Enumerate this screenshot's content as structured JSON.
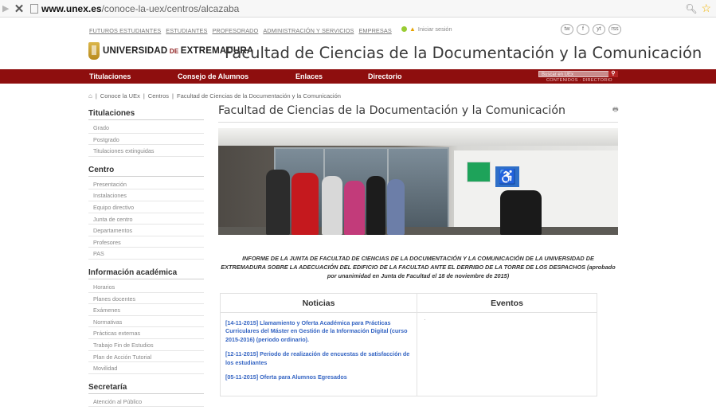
{
  "browser": {
    "url_host": "www.unex.es",
    "url_path": "/conoce-la-uex/centros/alcazaba"
  },
  "toplinks": [
    "Futuros estudiantes",
    "Estudiantes",
    "Profesorado",
    "Administración y servicios",
    "Empresas"
  ],
  "login_label": "Iniciar sesión",
  "social": [
    "tw",
    "f",
    "yt",
    "rss"
  ],
  "logo_text": {
    "a": "UNIVERSIDAD",
    "b": " DE ",
    "c": "EXTREMADURA"
  },
  "site_title": "Facultad de Ciencias de la Documentación y la Comunicación",
  "nav": {
    "items": [
      "Titulaciones",
      "Consejo de Alumnos",
      "Enlaces",
      "Directorio"
    ],
    "search_placeholder": "Buscar en UEx",
    "sub": "CONTENIDOS  ·  DIRECTORIO"
  },
  "breadcrumb": [
    "Conoce la UEx",
    "Centros",
    "Facultad de Ciencias de la Documentación y la Comunicación"
  ],
  "sidebar": [
    {
      "title": "Titulaciones",
      "items": [
        "Grado",
        "Postgrado",
        "Titulaciones extinguidas"
      ]
    },
    {
      "title": "Centro",
      "items": [
        "Presentación",
        "Instalaciones",
        "Equipo directivo",
        "Junta de centro",
        "Departamentos",
        "Profesores",
        "PAS"
      ]
    },
    {
      "title": "Información académica",
      "items": [
        "Horarios",
        "Planes docentes",
        "Exámenes",
        "Normativas",
        "Prácticas externas",
        "Trabajo Fin de Estudios",
        "Plan de Acción Tutorial",
        "Movilidad"
      ]
    },
    {
      "title": "Secretaría",
      "items": [
        "Atención al Público"
      ]
    }
  ],
  "page_title": "Facultad de Ciencias de la Documentación y la Comunicación",
  "notice": "INFORME DE LA JUNTA DE FACULTAD DE CIENCIAS DE LA DOCUMENTACIÓN Y LA COMUNICACIÓN DE LA UNIVERSIDAD DE EXTREMADURA SOBRE LA ADECUACIÓN DEL EDIFICIO DE LA FACULTAD ANTE EL DERRIBO DE LA TORRE DE LOS DESPACHOS (aprobado por unanimidad en Junta de Facultad el 18 de noviembre de 2015)",
  "news_header": "Noticias",
  "events_header": "Eventos",
  "news": [
    "[14-11-2015] Llamamiento y Oferta Académica para Prácticas Curriculares del Máster en Gestión de la Información Digital (curso 2015-2016) (periodo ordinario).",
    "[12-11-2015] Periodo de realización de encuestas de satisfacción de los estudiantes",
    "[05-11-2015] Oferta para Alumnos Egresados"
  ],
  "colors": {
    "nav_bg": "#8e0e0e",
    "link_blue": "#3565c3"
  }
}
